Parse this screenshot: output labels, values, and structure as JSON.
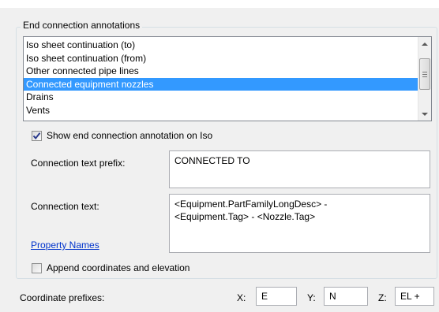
{
  "group": {
    "title": "End connection annotations"
  },
  "list": {
    "items": [
      {
        "label": "Iso sheet continuation (to)",
        "selected": false
      },
      {
        "label": "Iso sheet continuation (from)",
        "selected": false
      },
      {
        "label": "Other connected pipe lines",
        "selected": false
      },
      {
        "label": "Connected equipment nozzles",
        "selected": true
      },
      {
        "label": "Drains",
        "selected": false
      },
      {
        "label": "Vents",
        "selected": false
      }
    ],
    "selection_color": "#3399ff"
  },
  "show_annotation": {
    "label": "Show end connection annotation on Iso",
    "checked": true
  },
  "prefix": {
    "label": "Connection text prefix:",
    "value": "CONNECTED TO"
  },
  "connection_text": {
    "label": "Connection text:",
    "value": "<Equipment.PartFamilyLongDesc> -\n<Equipment.Tag> - <Nozzle.Tag>"
  },
  "property_names": {
    "label": "Property Names",
    "color": "#0033cc"
  },
  "append_coords": {
    "label": "Append coordinates and elevation",
    "checked": false
  },
  "coordinates": {
    "label": "Coordinate prefixes:",
    "x_label": "X:",
    "x_value": "E",
    "y_label": "Y:",
    "y_value": "N",
    "z_label": "Z:",
    "z_value": "EL +"
  }
}
